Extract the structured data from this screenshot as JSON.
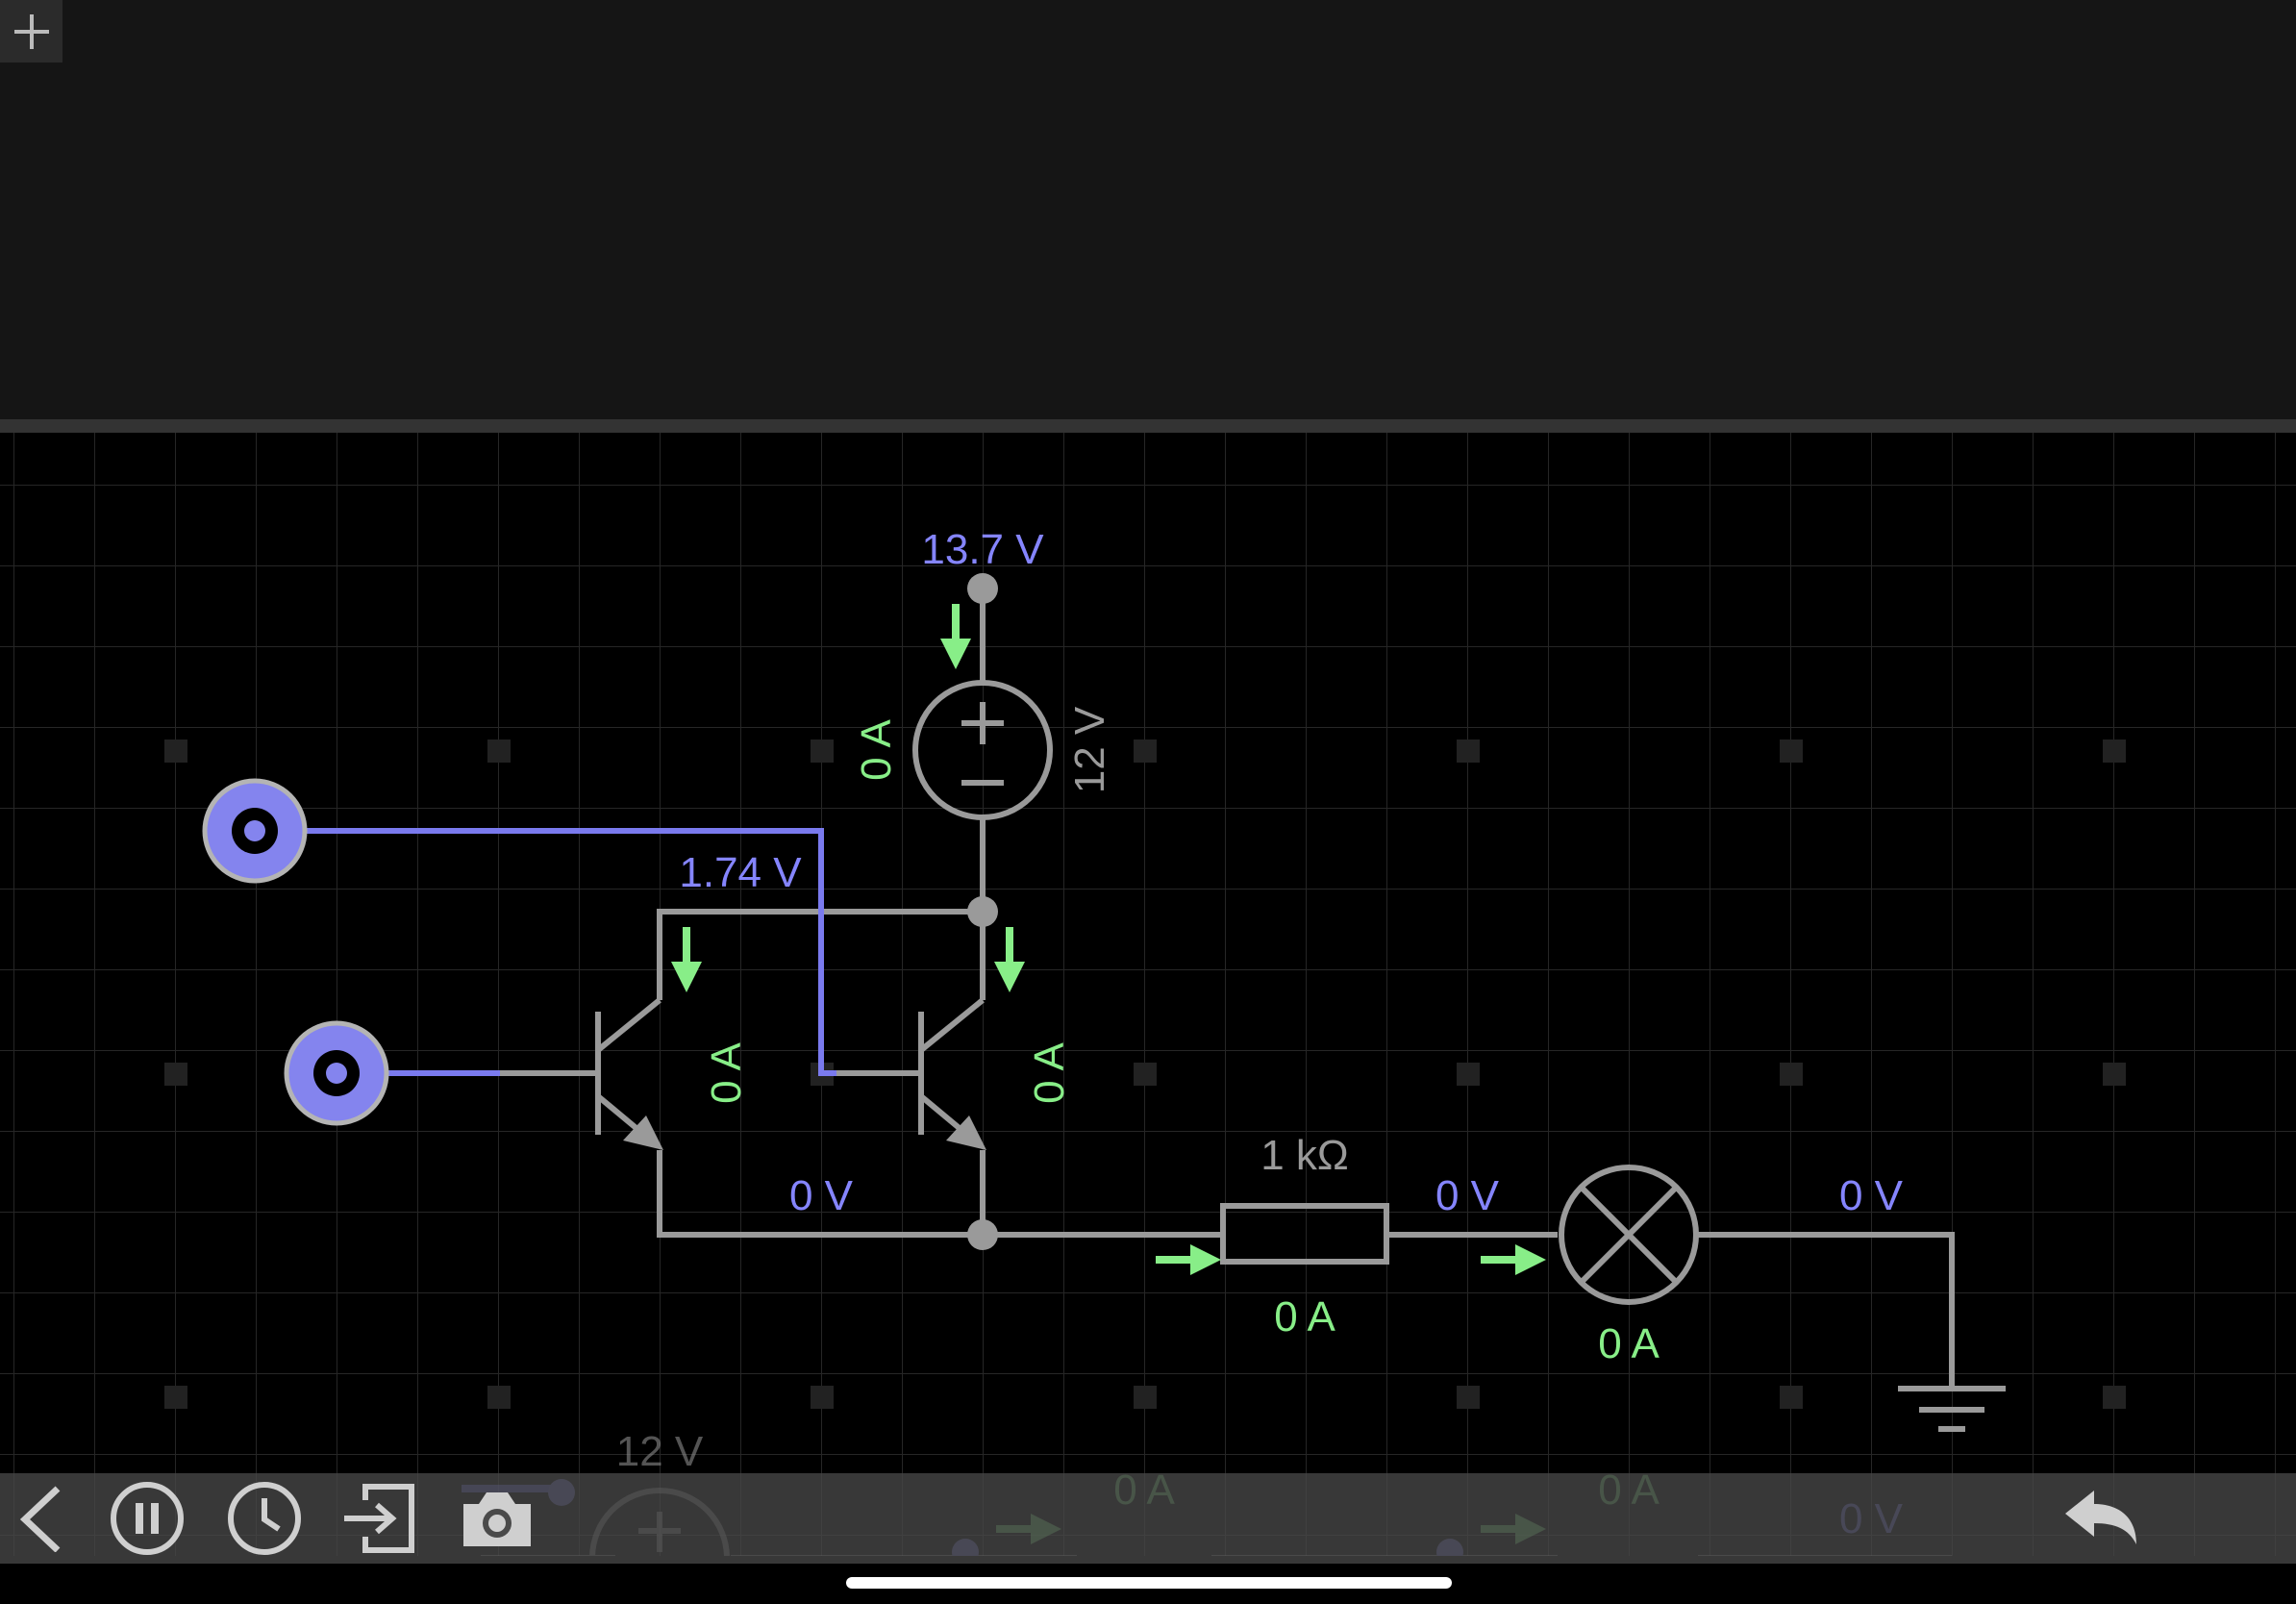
{
  "colors": {
    "wire": "#9a9a9a",
    "voltage_label": "#8585ff",
    "current_label": "#88ee88",
    "probe_wire": "#7a7aee",
    "background": "#000000",
    "grid": "#252525",
    "top_panel": "#151515"
  },
  "icons": {
    "add": "plus-icon",
    "back": "chevron-left-icon",
    "pause": "pause-icon",
    "history": "clock-icon",
    "export": "export-icon",
    "screenshot": "camera-icon",
    "undo": "undo-icon"
  },
  "circuit": {
    "voltage_labels": {
      "supply_top": "13.7 V",
      "base_node": "1.74 V",
      "emitter_node": "0 V",
      "resistor_right": "0 V",
      "lamp_right": "0 V"
    },
    "current_labels": {
      "supply": "0 A",
      "transistor_left": "0 A",
      "transistor_right": "0 A",
      "resistor": "0 A",
      "lamp": "0 A"
    },
    "component_labels": {
      "battery": "12 V",
      "resistor": "1 kΩ"
    }
  },
  "ghost": {
    "battery": "12 V",
    "current_1": "0 A",
    "current_2": "0 A",
    "voltage": "0 V"
  }
}
